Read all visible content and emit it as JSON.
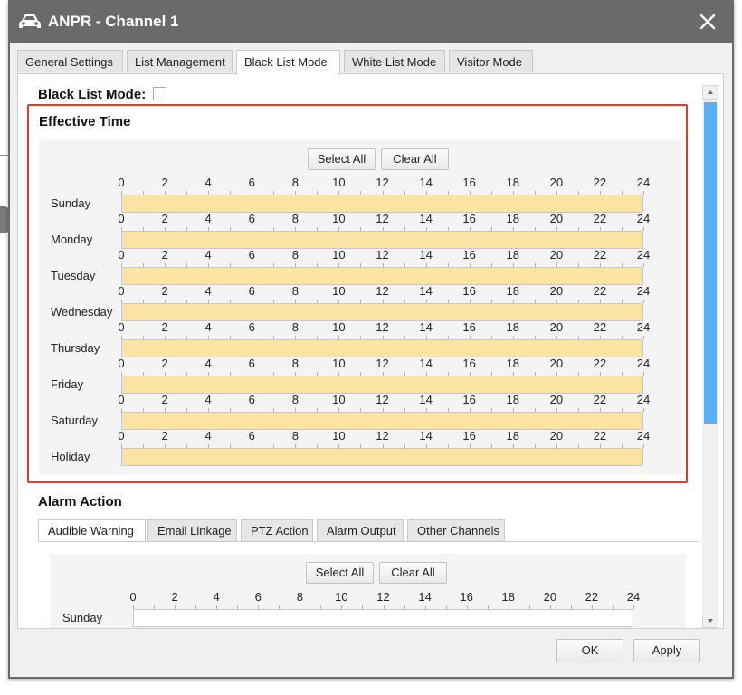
{
  "window": {
    "title": "ANPR - Channel 1",
    "titlebar_color": "#6a6a6a"
  },
  "tabs": [
    {
      "label": "General Settings",
      "active": false
    },
    {
      "label": "List Management",
      "active": false
    },
    {
      "label": "Black List Mode",
      "active": true
    },
    {
      "label": "White List Mode",
      "active": false
    },
    {
      "label": "Visitor Mode",
      "active": false
    }
  ],
  "black_list_mode": {
    "label": "Black List Mode:",
    "checked": false
  },
  "effective_time": {
    "title": "Effective Time",
    "select_all": "Select All",
    "clear_all": "Clear All",
    "tick_labels": [
      "0",
      "2",
      "4",
      "6",
      "8",
      "10",
      "12",
      "14",
      "16",
      "18",
      "20",
      "22",
      "24"
    ],
    "days": [
      {
        "name": "Sunday",
        "from": 0,
        "to": 24
      },
      {
        "name": "Monday",
        "from": 0,
        "to": 24
      },
      {
        "name": "Tuesday",
        "from": 0,
        "to": 24
      },
      {
        "name": "Wednesday",
        "from": 0,
        "to": 24
      },
      {
        "name": "Thursday",
        "from": 0,
        "to": 24
      },
      {
        "name": "Friday",
        "from": 0,
        "to": 24
      },
      {
        "name": "Saturday",
        "from": 0,
        "to": 24
      },
      {
        "name": "Holiday",
        "from": 0,
        "to": 24
      }
    ],
    "fill_color": "#fbe3a3",
    "highlight_color": "#e23a2e"
  },
  "alarm_action": {
    "title": "Alarm Action",
    "tabs": [
      {
        "label": "Audible Warning",
        "active": true
      },
      {
        "label": "Email Linkage",
        "active": false
      },
      {
        "label": "PTZ Action",
        "active": false
      },
      {
        "label": "Alarm Output",
        "active": false
      },
      {
        "label": "Other Channels",
        "active": false
      }
    ],
    "select_all": "Select All",
    "clear_all": "Clear All",
    "tick_labels": [
      "0",
      "2",
      "4",
      "6",
      "8",
      "10",
      "12",
      "14",
      "16",
      "18",
      "20",
      "22",
      "24"
    ],
    "days": [
      {
        "name": "Sunday",
        "from": 0,
        "to": 0
      }
    ]
  },
  "footer": {
    "ok": "OK",
    "apply": "Apply"
  },
  "scrollbar": {
    "thumb_color": "#5aaef1"
  },
  "icons": {
    "title": "car-icon",
    "close": "close-icon"
  }
}
